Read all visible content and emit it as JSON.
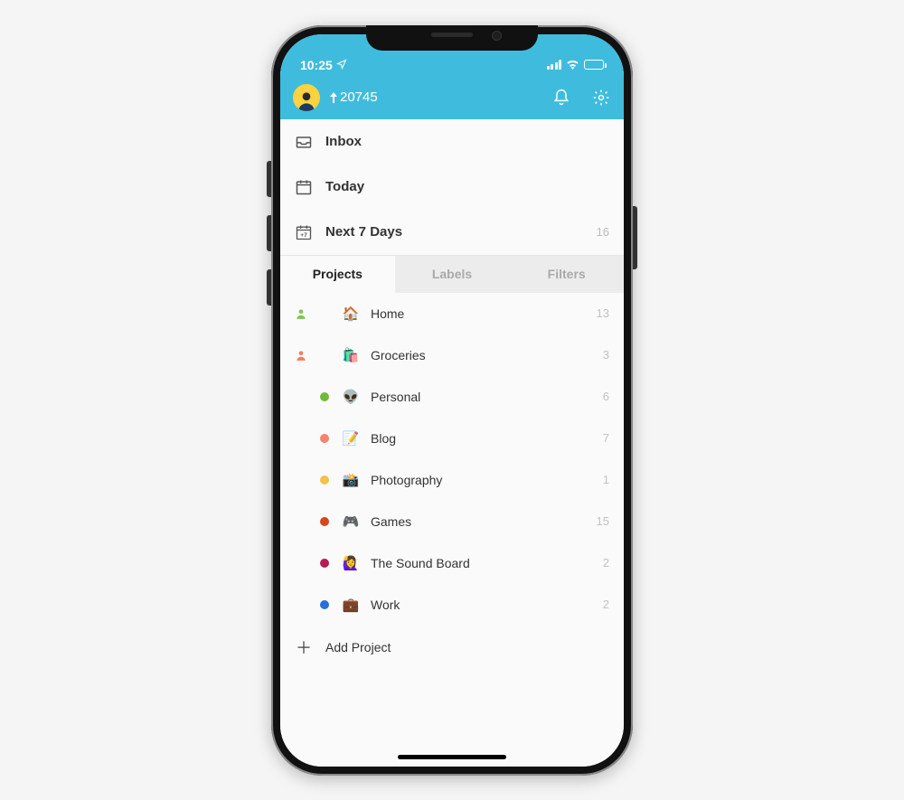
{
  "statusbar": {
    "time": "10:25"
  },
  "header": {
    "karma": "20745"
  },
  "nav": {
    "inbox": {
      "label": "Inbox",
      "count": ""
    },
    "today": {
      "label": "Today",
      "count": ""
    },
    "next7": {
      "label": "Next 7 Days",
      "count": "16"
    }
  },
  "tabs": {
    "projects": "Projects",
    "labels": "Labels",
    "filters": "Filters"
  },
  "projects": [
    {
      "shared": true,
      "emoji": "🏠",
      "name": "Home",
      "count": "13",
      "share_color": "#7fc54f"
    },
    {
      "shared": true,
      "emoji": "🛍️",
      "name": "Groceries",
      "count": "3",
      "share_color": "#f47e5d"
    },
    {
      "shared": false,
      "emoji": "👽",
      "name": "Personal",
      "count": "6",
      "dot": "#6fba3c"
    },
    {
      "shared": false,
      "emoji": "📝",
      "name": "Blog",
      "count": "7",
      "dot": "#f6836b"
    },
    {
      "shared": false,
      "emoji": "📸",
      "name": "Photography",
      "count": "1",
      "dot": "#f6c04a"
    },
    {
      "shared": false,
      "emoji": "🎮",
      "name": "Games",
      "count": "15",
      "dot": "#d4471f"
    },
    {
      "shared": false,
      "emoji": "🙋‍♀️",
      "name": "The Sound Board",
      "count": "2",
      "dot": "#b81a54"
    },
    {
      "shared": false,
      "emoji": "💼",
      "name": "Work",
      "count": "2",
      "dot": "#2a6fd6"
    }
  ],
  "add_project": "Add Project"
}
